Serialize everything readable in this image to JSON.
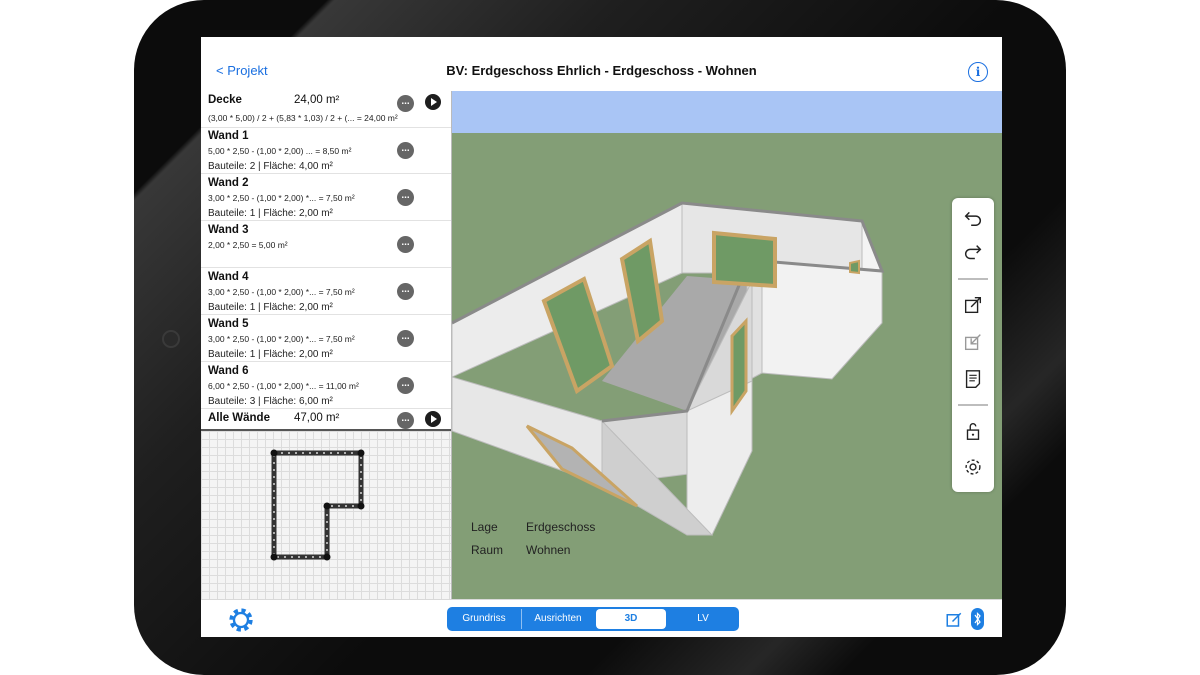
{
  "header": {
    "back_label": "< Projekt",
    "title": "BV: Erdgeschoss Ehrlich - Erdgeschoss - Wohnen"
  },
  "list": [
    {
      "title": "Decke",
      "value": "24,00 m²",
      "formula": "(3,00 * 5,00) / 2  + (5,83 * 1,03) / 2  + (... = 24,00 m²",
      "summary": "",
      "has_play": true
    },
    {
      "title": "Wand 1",
      "value": "",
      "formula": "5,00 * 2,50  - (1,00 * 2,00)  ... = 8,50 m²",
      "summary": "Bauteile: 2 | Fläche: 4,00 m²",
      "has_play": false
    },
    {
      "title": "Wand 2",
      "value": "",
      "formula": "3,00 * 2,50  - (1,00 * 2,00) *... = 7,50 m²",
      "summary": "Bauteile: 1 | Fläche: 2,00 m²",
      "has_play": false
    },
    {
      "title": "Wand 3",
      "value": "",
      "formula": "2,00 * 2,50   = 5,00 m²",
      "summary": "",
      "has_play": false
    },
    {
      "title": "Wand 4",
      "value": "",
      "formula": "3,00 * 2,50  - (1,00 * 2,00) *... = 7,50 m²",
      "summary": "Bauteile: 1 | Fläche: 2,00 m²",
      "has_play": false
    },
    {
      "title": "Wand 5",
      "value": "",
      "formula": "3,00 * 2,50  - (1,00 * 2,00) *... = 7,50 m²",
      "summary": "Bauteile: 1 | Fläche: 2,00 m²",
      "has_play": false
    },
    {
      "title": "Wand 6",
      "value": "",
      "formula": "6,00 * 2,50  - (1,00 * 2,00) *... = 11,00 m²",
      "summary": "Bauteile: 3 | Fläche: 6,00 m²",
      "has_play": false
    },
    {
      "title": "Alle Wände",
      "value": "47,00 m²",
      "formula": "",
      "summary": "",
      "has_play": true
    }
  ],
  "more_label": "...",
  "meta": {
    "lage_label": "Lage",
    "lage_value": "Erdgeschoss",
    "raum_label": "Raum",
    "raum_value": "Wohnen"
  },
  "toolbar_icons": [
    "undo-icon",
    "redo-icon",
    "export-icon",
    "import-icon",
    "document-icon",
    "lock-icon",
    "settings-icon"
  ],
  "segments": [
    {
      "label": "Grundriss",
      "active": false
    },
    {
      "label": "Ausrichten",
      "active": false
    },
    {
      "label": "3D",
      "active": true
    },
    {
      "label": "LV",
      "active": false
    }
  ],
  "colors": {
    "accent": "#1e7fe2",
    "sky": "#a9c5f5",
    "ground": "#839e76",
    "floor": "#a9a9a9",
    "wall": "#f0f0f0",
    "door_frame": "#c9a464",
    "glass": "#6f9a65"
  }
}
